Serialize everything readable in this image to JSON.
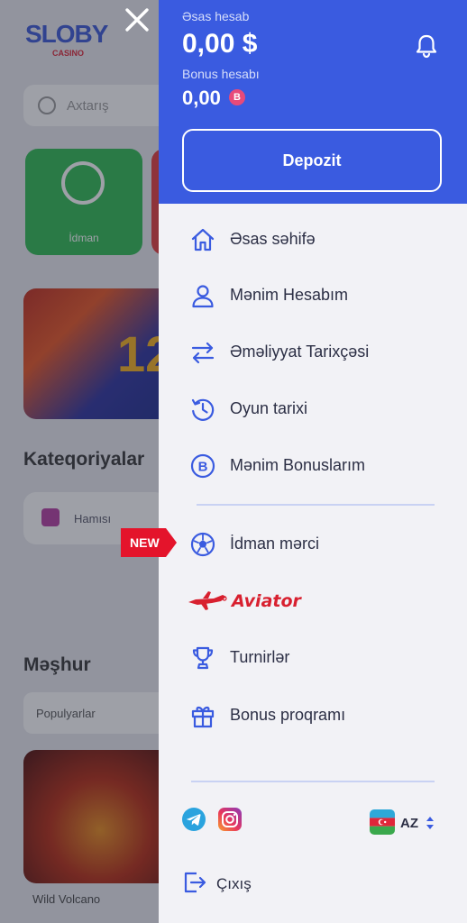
{
  "colors": {
    "accent": "#3a5be0",
    "drawer_bg": "#f2f2f6",
    "icon": "#3a5be0",
    "new_badge": "#e4142b",
    "aviator": "#d8202f"
  },
  "background": {
    "search_placeholder": "Axtarış",
    "tile_label": "İdman",
    "categories_title": "Kateqoriyalar",
    "chip_label": "Hamısı",
    "popular_title": "Məşhur",
    "filter_label": "Populyarlar",
    "game_label": "Wild Volcano"
  },
  "header": {
    "main_account_label": "Əsas hesab",
    "main_account_value": "0,00 $",
    "bonus_account_label": "Bonus hesabı",
    "bonus_account_value": "0,00",
    "bonus_badge": "B",
    "deposit_label": "Depozit",
    "bell_icon": "bell-icon",
    "close_icon": "close-icon"
  },
  "menu": {
    "items": [
      {
        "label": "Əsas səhifə",
        "icon": "home-icon"
      },
      {
        "label": "Mənim Hesabım",
        "icon": "user-icon"
      },
      {
        "label": "Əməliyyat Tarixçəsi",
        "icon": "transfer-icon"
      },
      {
        "label": "Oyun tarixi",
        "icon": "history-icon"
      },
      {
        "label": "Mənim Bonuslarım",
        "icon": "bonus-b-icon"
      }
    ],
    "new_badge": "NEW",
    "sports": {
      "label": "İdman mərci",
      "icon": "soccer-ball-icon"
    },
    "aviator": {
      "label": "Aviator",
      "icon": "aviator-plane-icon"
    },
    "tournaments": {
      "label": "Turnirlər",
      "icon": "trophy-icon"
    },
    "bonus_program": {
      "label": "Bonus proqramı",
      "icon": "gift-icon"
    }
  },
  "footer": {
    "social": [
      "telegram-icon",
      "instagram-icon"
    ],
    "language": "AZ",
    "logout_label": "Çıxış"
  }
}
